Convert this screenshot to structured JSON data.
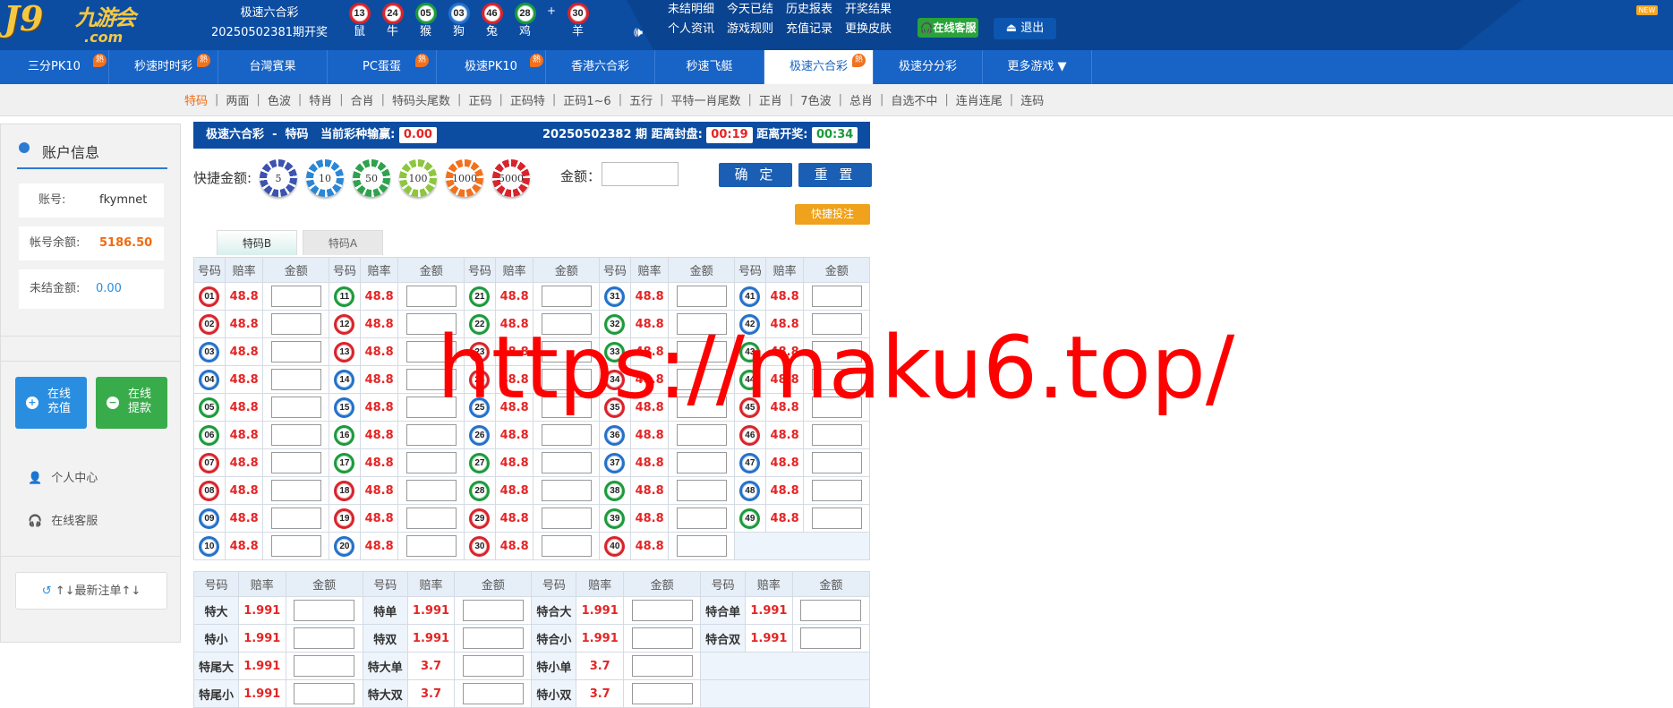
{
  "header": {
    "logo_text": "J9",
    "logo_cn": "九游会",
    "logo_sub": ".com",
    "game_name": "极速六合彩",
    "period_label": "20250502381期开奖",
    "draw_balls": [
      {
        "num": "13",
        "zodiac": "鼠",
        "color": "red"
      },
      {
        "num": "24",
        "zodiac": "牛",
        "color": "red"
      },
      {
        "num": "05",
        "zodiac": "猴",
        "color": "green"
      },
      {
        "num": "03",
        "zodiac": "狗",
        "color": "blue"
      },
      {
        "num": "46",
        "zodiac": "兔",
        "color": "red"
      },
      {
        "num": "28",
        "zodiac": "鸡",
        "color": "green"
      }
    ],
    "plus": "+",
    "special_ball": {
      "num": "30",
      "zodiac": "羊",
      "color": "red"
    },
    "links": [
      "未结明细",
      "今天已结",
      "历史报表",
      "开奖结果",
      "个人资讯",
      "游戏规则",
      "充值记录",
      "更换皮肤"
    ],
    "kefu_label": "在线客服",
    "logout_label": "退出",
    "new_badge": "NEW"
  },
  "nav": {
    "items": [
      {
        "label": "三分PK10",
        "hot": true
      },
      {
        "label": "秒速时时彩",
        "hot": true
      },
      {
        "label": "台灣賓果",
        "hot": false
      },
      {
        "label": "PC蛋蛋",
        "hot": true
      },
      {
        "label": "极速PK10",
        "hot": true
      },
      {
        "label": "香港六合彩",
        "hot": false
      },
      {
        "label": "秒速飞艇",
        "hot": false
      },
      {
        "label": "极速六合彩",
        "hot": true,
        "active": true
      },
      {
        "label": "极速分分彩",
        "hot": false
      },
      {
        "label": "更多游戏 ▼",
        "hot": false
      }
    ],
    "hot_label": "熱"
  },
  "subnav": [
    "特码",
    "两面",
    "色波",
    "特肖",
    "合肖",
    "特码头尾数",
    "正码",
    "正码特",
    "正码1~6",
    "五行",
    "平特一肖尾数",
    "正肖",
    "7色波",
    "总肖",
    "自选不中",
    "连肖连尾",
    "连码"
  ],
  "sidebar": {
    "title": "账户信息",
    "account_label": "账号:",
    "account_value": "fkymnet",
    "balance_label": "帐号余额:",
    "balance_value": "5186.50",
    "unsettled_label": "未结金额:",
    "unsettled_value": "0.00",
    "recharge_label": "在线\n充值",
    "withdraw_label": "在线\n提款",
    "personal_center": "个人中心",
    "online_service": "在线客服",
    "latest_bets": "↑↓最新注单↑↓"
  },
  "status_bar": {
    "game": "极速六合彩",
    "dash": "-",
    "play": "特码",
    "win_loss_label": "当前彩种输赢:",
    "win_loss_value": "0.00",
    "period": "20250502382 期",
    "close_label": "距离封盘:",
    "close_time": "00:19",
    "open_label": "距离开奖:",
    "open_time": "00:34"
  },
  "quick": {
    "label": "快捷金额:",
    "chips": [
      {
        "value": "5",
        "color": "#3c53b0"
      },
      {
        "value": "10",
        "color": "#2a87d6"
      },
      {
        "value": "50",
        "color": "#2ea24d"
      },
      {
        "value": "100",
        "color": "#8dc63f"
      },
      {
        "value": "1000",
        "color": "#f2711c"
      },
      {
        "value": "5000",
        "color": "#d8242c"
      }
    ],
    "amount_label": "金额：",
    "confirm_label": "确 定",
    "reset_label": "重 置",
    "fast_bet_label": "快捷投注"
  },
  "tabs": [
    "特码B",
    "特码A"
  ],
  "num_table": {
    "headers": [
      "号码",
      "赔率",
      "金额"
    ],
    "odds": "48.8",
    "columns": [
      [
        [
          "01",
          "red"
        ],
        [
          "02",
          "red"
        ],
        [
          "03",
          "blue"
        ],
        [
          "04",
          "blue"
        ],
        [
          "05",
          "green"
        ],
        [
          "06",
          "green"
        ],
        [
          "07",
          "red"
        ],
        [
          "08",
          "red"
        ],
        [
          "09",
          "blue"
        ],
        [
          "10",
          "blue"
        ]
      ],
      [
        [
          "11",
          "green"
        ],
        [
          "12",
          "red"
        ],
        [
          "13",
          "red"
        ],
        [
          "14",
          "blue"
        ],
        [
          "15",
          "blue"
        ],
        [
          "16",
          "green"
        ],
        [
          "17",
          "green"
        ],
        [
          "18",
          "red"
        ],
        [
          "19",
          "red"
        ],
        [
          "20",
          "blue"
        ]
      ],
      [
        [
          "21",
          "green"
        ],
        [
          "22",
          "green"
        ],
        [
          "23",
          "red"
        ],
        [
          "24",
          "red"
        ],
        [
          "25",
          "blue"
        ],
        [
          "26",
          "blue"
        ],
        [
          "27",
          "green"
        ],
        [
          "28",
          "green"
        ],
        [
          "29",
          "red"
        ],
        [
          "30",
          "red"
        ]
      ],
      [
        [
          "31",
          "blue"
        ],
        [
          "32",
          "green"
        ],
        [
          "33",
          "green"
        ],
        [
          "34",
          "red"
        ],
        [
          "35",
          "red"
        ],
        [
          "36",
          "blue"
        ],
        [
          "37",
          "blue"
        ],
        [
          "38",
          "green"
        ],
        [
          "39",
          "green"
        ],
        [
          "40",
          "red"
        ]
      ],
      [
        [
          "41",
          "blue"
        ],
        [
          "42",
          "blue"
        ],
        [
          "43",
          "green"
        ],
        [
          "44",
          "green"
        ],
        [
          "45",
          "red"
        ],
        [
          "46",
          "red"
        ],
        [
          "47",
          "blue"
        ],
        [
          "48",
          "blue"
        ],
        [
          "49",
          "green"
        ]
      ]
    ]
  },
  "two_table": {
    "headers": [
      "号码",
      "赔率",
      "金额"
    ],
    "rows": [
      [
        [
          "特大",
          "1.991"
        ],
        [
          "特单",
          "1.991"
        ],
        [
          "特合大",
          "1.991"
        ],
        [
          "特合单",
          "1.991"
        ]
      ],
      [
        [
          "特小",
          "1.991"
        ],
        [
          "特双",
          "1.991"
        ],
        [
          "特合小",
          "1.991"
        ],
        [
          "特合双",
          "1.991"
        ]
      ],
      [
        [
          "特尾大",
          "1.991"
        ],
        [
          "特大单",
          "3.7"
        ],
        [
          "特小单",
          "3.7"
        ],
        null
      ],
      [
        [
          "特尾小",
          "1.991"
        ],
        [
          "特大双",
          "3.7"
        ],
        [
          "特小双",
          "3.7"
        ],
        null
      ]
    ]
  },
  "watermark": "https://maku6.top/"
}
